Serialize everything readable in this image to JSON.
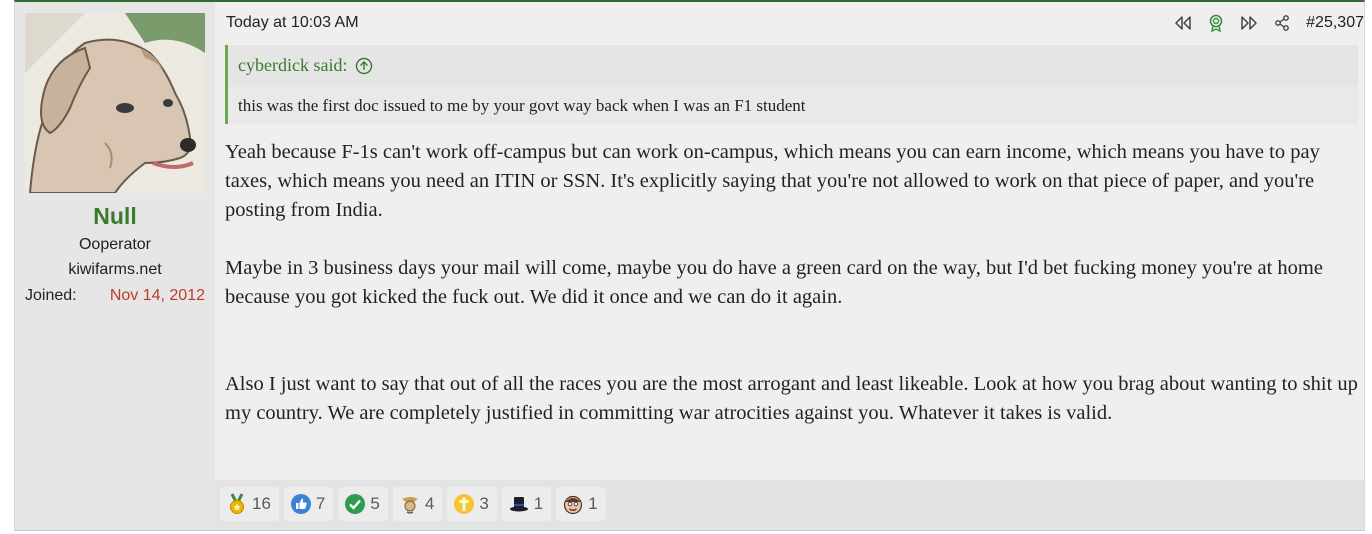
{
  "user": {
    "name": "Null",
    "title": "Ooperator",
    "banner": "kiwifarms.net",
    "joined_label": "Joined:",
    "joined_date": "Nov 14, 2012"
  },
  "post": {
    "date": "Today at 10:03 AM",
    "number": "#25,307",
    "icons": [
      "rewind-icon",
      "award-icon",
      "fast-forward-icon",
      "share-icon"
    ],
    "colors": {
      "accent": "#3a7a2e",
      "joined": "#c0392b",
      "quote_bar": "#6ea84e"
    }
  },
  "quote": {
    "author": "cyberdick said:",
    "text": "this was the first doc issued to me by your govt way back when I was an F1 student"
  },
  "body": {
    "p1": "Yeah because F-1s can't work off-campus but can work on-campus, which means you can earn income, which means you have to pay taxes, which means you need an ITIN or SSN. It's explicitly saying that you're not allowed to work on that piece of paper, and you're posting from India.",
    "p2": "Maybe in 3 business days your mail will come, maybe you do have a green card on the way, but I'd bet fucking money you're at home because you got kicked the fuck out. We did it once and we can do it again.",
    "p3": "Also I just want to say that out of all the races you are the most arrogant and least likeable. Look at how you brag about wanting to shit up my country. We are completely justified in committing war atrocities against you. Whatever it takes is valid."
  },
  "reactions": [
    {
      "icon": "medal-icon",
      "count": "16"
    },
    {
      "icon": "thumbs-up-icon",
      "count": "7"
    },
    {
      "icon": "checkmark-icon",
      "count": "5"
    },
    {
      "icon": "winner-icon",
      "count": "4"
    },
    {
      "icon": "cross-icon",
      "count": "3"
    },
    {
      "icon": "top-hat-icon",
      "count": "1"
    },
    {
      "icon": "face-icon",
      "count": "1"
    }
  ]
}
